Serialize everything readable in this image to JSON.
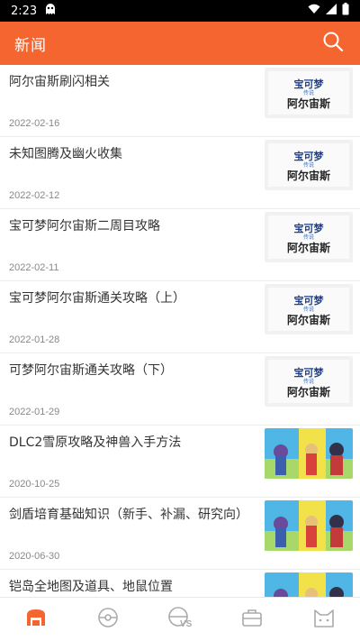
{
  "status_bar": {
    "time": "2:23",
    "app_icon": "ghost-icon",
    "wifi_icon": "wifi-icon",
    "signal_icon": "signal-icon",
    "battery_icon": "battery-icon"
  },
  "header": {
    "title": "新闻",
    "search_icon": "search-icon",
    "background_color": "#f4652f"
  },
  "news": [
    {
      "title": "阿尔宙斯刷闪相关",
      "date": "2022-02-16",
      "thumbnail": "legends-arceus-logo"
    },
    {
      "title": "未知图腾及幽火收集",
      "date": "2022-02-12",
      "thumbnail": "legends-arceus-logo"
    },
    {
      "title": "宝可梦阿尔宙斯二周目攻略",
      "date": "2022-02-11",
      "thumbnail": "legends-arceus-logo"
    },
    {
      "title": "宝可梦阿尔宙斯通关攻略（上）",
      "date": "2022-01-28",
      "thumbnail": "legends-arceus-logo"
    },
    {
      "title": "可梦阿尔宙斯通关攻略（下）",
      "date": "2022-01-29",
      "thumbnail": "legends-arceus-logo"
    },
    {
      "title": "DLC2雪原攻略及神兽入手方法",
      "date": "2020-10-25",
      "thumbnail": "sword-shield-artwork"
    },
    {
      "title": "剑盾培育基础知识（新手、补漏、研究向）",
      "date": "2020-06-30",
      "thumbnail": "sword-shield-artwork"
    },
    {
      "title": "铠岛全地图及道具、地鼠位置",
      "date": "",
      "thumbnail": "sword-shield-artwork"
    }
  ],
  "bottom_nav": [
    {
      "name": "news",
      "icon": "home-icon",
      "active": true,
      "color": "#f4652f"
    },
    {
      "name": "pokedex",
      "icon": "pokeball-icon",
      "active": false
    },
    {
      "name": "battle",
      "icon": "vs-icon",
      "active": false
    },
    {
      "name": "items",
      "icon": "bag-icon",
      "active": false
    },
    {
      "name": "profile",
      "icon": "cat-face-icon",
      "active": false
    }
  ]
}
